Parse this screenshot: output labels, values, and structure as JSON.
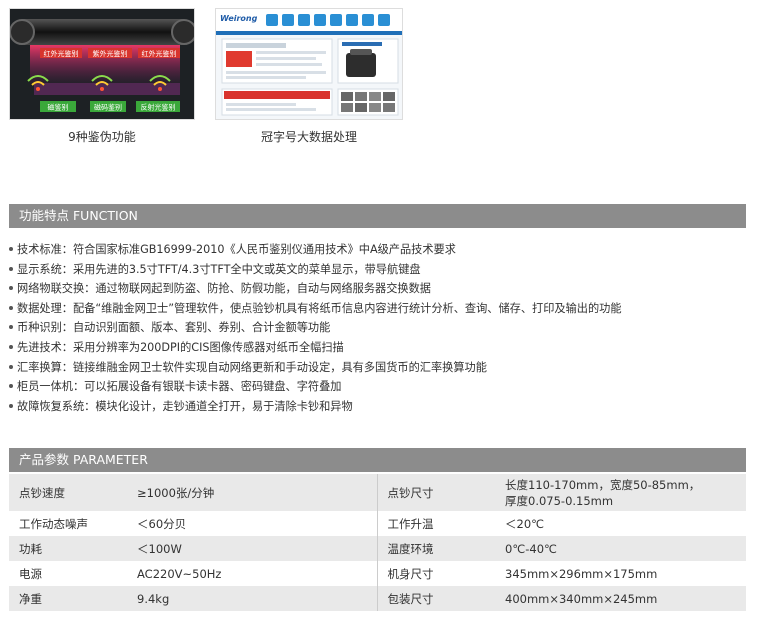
{
  "thumbnails": [
    {
      "caption": "9种鉴伪功能",
      "labels_top": [
        "红外光鉴别",
        "紫外光鉴别",
        "红外光鉴别"
      ],
      "labels_bottom": [
        "磁鉴别",
        "磁码鉴别",
        "反射光鉴别"
      ]
    },
    {
      "caption": "冠字号大数据处理",
      "brand": "Weirong"
    }
  ],
  "function_section": {
    "title": "功能特点 FUNCTION",
    "items": [
      "技术标准：符合国家标准GB16999-2010《人民币鉴别仪通用技术》中A级产品技术要求",
      "显示系统：采用先进的3.5寸TFT/4.3寸TFT全中文或英文的菜单显示，带导航键盘",
      "网络物联交换：通过物联网起到防盗、防抢、防假功能，自动与网络服务器交换数据",
      "数据处理：配备“维融金网卫士”管理软件，使点验钞机具有将纸币信息内容进行统计分析、查询、储存、打印及输出的功能",
      "币种识别：自动识别面额、版本、套别、券别、合计金额等功能",
      "先进技术：采用分辨率为200DPI的CIS图像传感器对纸币全幅扫描",
      "汇率换算：链接维融金网卫士软件实现自动网络更新和手动设定，具有多国货币的汇率换算功能",
      "柜员一体机：可以拓展设备有银联卡读卡器、密码键盘、字符叠加",
      "故障恢复系统：模块化设计，走钞通道全打开，易于清除卡钞和异物"
    ]
  },
  "parameter_section": {
    "title": "产品参数 PARAMETER",
    "rows": [
      {
        "k1": "点钞速度",
        "v1": "≥1000张/分钟",
        "k2": "点钞尺寸",
        "v2": "长度110-170mm，宽度50-85mm，",
        "v2b": "厚度0.075-0.15mm"
      },
      {
        "k1": "工作动态噪声",
        "v1": "＜60分贝",
        "k2": "工作升温",
        "v2": "＜20℃"
      },
      {
        "k1": "功耗",
        "v1": "＜100W",
        "k2": "温度环境",
        "v2": "0℃-40℃"
      },
      {
        "k1": "电源",
        "v1": "AC220V~50Hz",
        "k2": "机身尺寸",
        "v2": "345mm×296mm×175mm"
      },
      {
        "k1": "净重",
        "v1": "9.4kg",
        "k2": "包装尺寸",
        "v2": "400mm×340mm×245mm"
      }
    ]
  },
  "colors": {
    "section_bar": "#8c8c8c",
    "row_alt": "#e9e9e9",
    "text": "#333333"
  }
}
